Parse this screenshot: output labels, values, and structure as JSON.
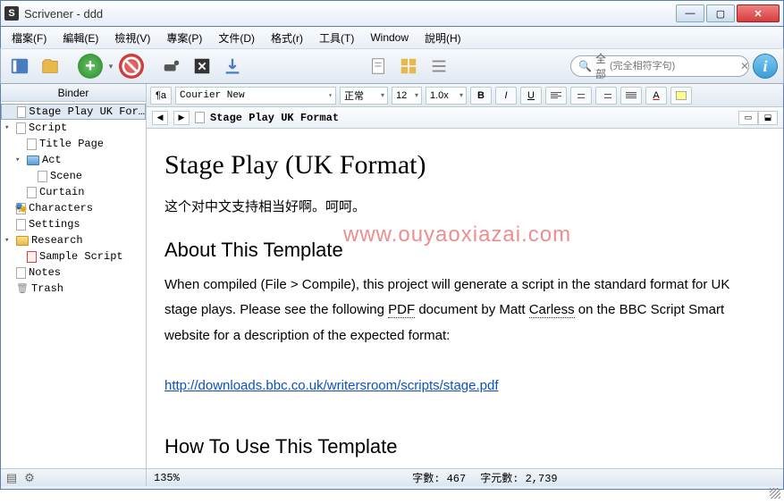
{
  "window": {
    "title": "Scrivener - ddd"
  },
  "menus": [
    "檔案(F)",
    "編輯(E)",
    "檢視(V)",
    "專案(P)",
    "文件(D)",
    "格式(r)",
    "工具(T)",
    "Window",
    "說明(H)"
  ],
  "search": {
    "scope": "全部",
    "placeholder": "(完全相符字句)"
  },
  "binder": {
    "title": "Binder",
    "items": [
      {
        "label": "Stage Play UK For…",
        "icon": "doc",
        "selected": true,
        "indent": 0
      },
      {
        "label": "Script",
        "icon": "doc",
        "arrow": "▾",
        "indent": 0
      },
      {
        "label": "Title Page",
        "icon": "doc",
        "indent": 1
      },
      {
        "label": "Act",
        "icon": "folder-blue",
        "arrow": "▾",
        "indent": 1
      },
      {
        "label": "Scene",
        "icon": "doc",
        "indent": 2
      },
      {
        "label": "Curtain",
        "icon": "doc",
        "indent": 1
      },
      {
        "label": "Characters",
        "icon": "mask",
        "indent": 0
      },
      {
        "label": "Settings",
        "icon": "doc",
        "indent": 0
      },
      {
        "label": "Research",
        "icon": "folder",
        "arrow": "▾",
        "indent": 0
      },
      {
        "label": "Sample Script",
        "icon": "doc-red",
        "indent": 1
      },
      {
        "label": "Notes",
        "icon": "doc",
        "indent": 0
      },
      {
        "label": "Trash",
        "icon": "trash",
        "indent": 0
      }
    ]
  },
  "format": {
    "font": "Courier New",
    "style": "正常",
    "size": "12",
    "spacing": "1.0x"
  },
  "path": {
    "title": "Stage Play UK Format"
  },
  "doc": {
    "h1": "Stage Play (UK Format)",
    "chinese": "这个对中文支持相当好啊。呵呵。",
    "h2a": "About This Template",
    "para1a": "When compiled (File > Compile), this project will generate a script in the standard format for UK stage plays. Please see the following ",
    "pdf": "PDF",
    "para1b": " document by Matt ",
    "carless": "Carless",
    "para1c": " on the BBC Script Smart website for a description of the expected format:",
    "link": "http://downloads.bbc.co.uk/writersroom/scripts/stage.pdf",
    "h2b": "How To Use This Template"
  },
  "watermark": "www.ouyaoxiazai.com",
  "status": {
    "zoom": "135%",
    "words_label": "字數:",
    "words": "467",
    "chars_label": "字元數:",
    "chars": "2,739"
  }
}
